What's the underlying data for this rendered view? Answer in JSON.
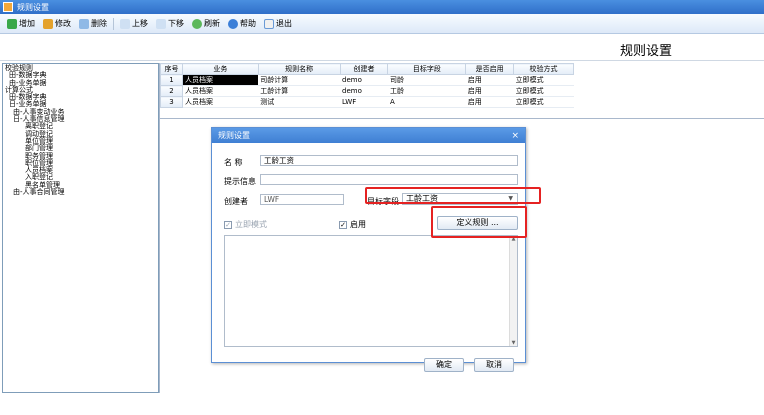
{
  "window": {
    "title": "规则设置"
  },
  "toolbar": {
    "add": "增加",
    "edit": "修改",
    "delete": "删除",
    "up": "上移",
    "down": "下移",
    "refresh": "刷新",
    "help": "帮助",
    "exit": "退出"
  },
  "page": {
    "title": "规则设置"
  },
  "tree": [
    "校验规则",
    "田-数据字典",
    "由-业务单据",
    "计算公式",
    "田-数据字典",
    "日-业务单据",
    "由-人事变动业务",
    "日-人事信息管理",
    "离职登记",
    "调动登记",
    "单位管理",
    "部门管理",
    "职务管理",
    "职位管理",
    "人员档案",
    "入职登记",
    "黑名单管理",
    "由-人事合同管理"
  ],
  "grid": {
    "headers": [
      "序号",
      "业务",
      "规则名称",
      "创建者",
      "目标字段",
      "是否启用",
      "校验方式"
    ],
    "rows": [
      [
        "1",
        "人员档案",
        "司龄计算",
        "demo",
        "司龄",
        "启用",
        "立即模式"
      ],
      [
        "2",
        "人员档案",
        "工龄计算",
        "demo",
        "工龄",
        "启用",
        "立即模式"
      ],
      [
        "3",
        "人员档案",
        "测试",
        "LWF",
        "A",
        "启用",
        "立即模式"
      ]
    ]
  },
  "dialog": {
    "title": "规则设置",
    "close": "×",
    "name_label": "名 称",
    "name_value": "工龄工资",
    "hint_label": "提示信息",
    "hint_value": "",
    "creator_label": "创建者",
    "creator_value": "LWF",
    "target_label": "目标字段",
    "target_value": "工龄工资",
    "immediate_label": "立即模式",
    "enable_label": "启用",
    "define_rule": "定义规则 ...",
    "ok": "确定",
    "cancel": "取消"
  },
  "colors": {
    "title_bar": "#3f7fd3",
    "highlight": "#e52222",
    "selected_cell": "#000000"
  }
}
